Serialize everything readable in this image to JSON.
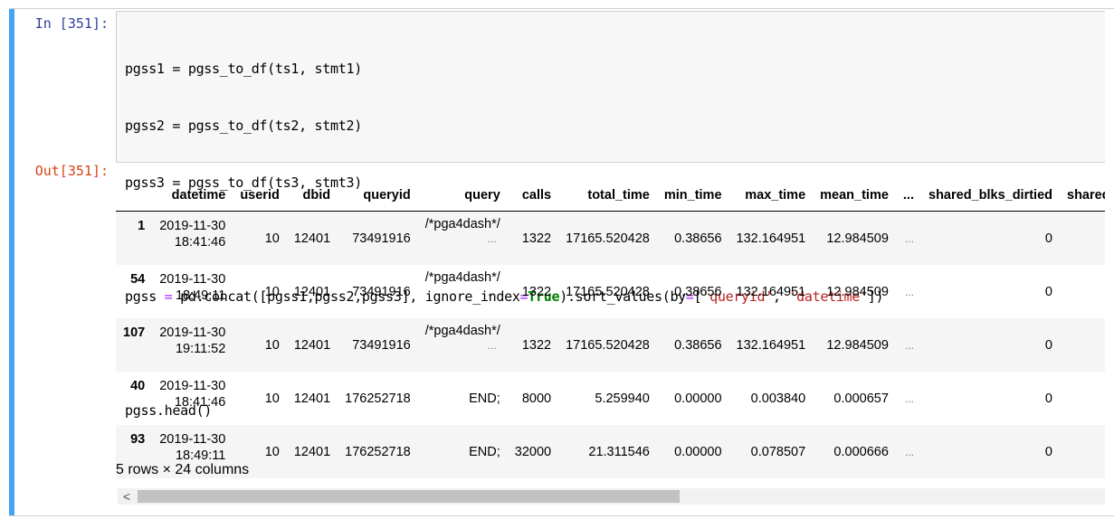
{
  "cell": {
    "in_prompt": "In [351]:",
    "out_prompt": "Out[351]:",
    "code_lines": [
      "pgss1 = pgss_to_df(ts1, stmt1)",
      "pgss2 = pgss_to_df(ts2, stmt2)",
      "pgss3 = pgss_to_df(ts3, stmt3)",
      "",
      "pgss = pd.concat([pgss1,pgss2,pgss3], ignore_index=True).sort_values(by=['queryid', 'datetime'])",
      "",
      "pgss.head()"
    ],
    "accent_color": "#42a5f5"
  },
  "table": {
    "columns": [
      "",
      "datetime",
      "userid",
      "dbid",
      "queryid",
      "query",
      "calls",
      "total_time",
      "min_time",
      "max_time",
      "mean_time",
      "...",
      "shared_blks_dirtied",
      "shared_"
    ],
    "rows": [
      {
        "index": "1",
        "date": "2019-11-30",
        "time": "18:41:46",
        "userid": "10",
        "dbid": "12401",
        "queryid": "73491916",
        "query": "/*pga4dash*/",
        "query_more": "...",
        "calls": "1322",
        "total_time": "17165.520428",
        "min_time": "0.38656",
        "max_time": "132.164951",
        "mean_time": "12.984509",
        "ellipsis": "...",
        "shared_blks_dirtied": "0"
      },
      {
        "index": "54",
        "date": "2019-11-30",
        "time": "18:49:11",
        "userid": "10",
        "dbid": "12401",
        "queryid": "73491916",
        "query": "/*pga4dash*/",
        "query_more": "...",
        "calls": "1322",
        "total_time": "17165.520428",
        "min_time": "0.38656",
        "max_time": "132.164951",
        "mean_time": "12.984509",
        "ellipsis": "...",
        "shared_blks_dirtied": "0"
      },
      {
        "index": "107",
        "date": "2019-11-30",
        "time": "19:11:52",
        "userid": "10",
        "dbid": "12401",
        "queryid": "73491916",
        "query": "/*pga4dash*/",
        "query_more": "...",
        "calls": "1322",
        "total_time": "17165.520428",
        "min_time": "0.38656",
        "max_time": "132.164951",
        "mean_time": "12.984509",
        "ellipsis": "...",
        "shared_blks_dirtied": "0"
      },
      {
        "index": "40",
        "date": "2019-11-30",
        "time": "18:41:46",
        "userid": "10",
        "dbid": "12401",
        "queryid": "176252718",
        "query": "END;",
        "query_more": "",
        "calls": "8000",
        "total_time": "5.259940",
        "min_time": "0.00000",
        "max_time": "0.003840",
        "mean_time": "0.000657",
        "ellipsis": "...",
        "shared_blks_dirtied": "0"
      },
      {
        "index": "93",
        "date": "2019-11-30",
        "time": "18:49:11",
        "userid": "10",
        "dbid": "12401",
        "queryid": "176252718",
        "query": "END;",
        "query_more": "",
        "calls": "32000",
        "total_time": "21.311546",
        "min_time": "0.00000",
        "max_time": "0.078507",
        "mean_time": "0.000666",
        "ellipsis": "...",
        "shared_blks_dirtied": "0"
      }
    ],
    "summary": "5 rows × 24 columns"
  },
  "scrollbar": {
    "left_arrow_icon": "chevron-left-icon",
    "left_arrow_glyph": "<",
    "thumb_fraction": 0.56
  }
}
